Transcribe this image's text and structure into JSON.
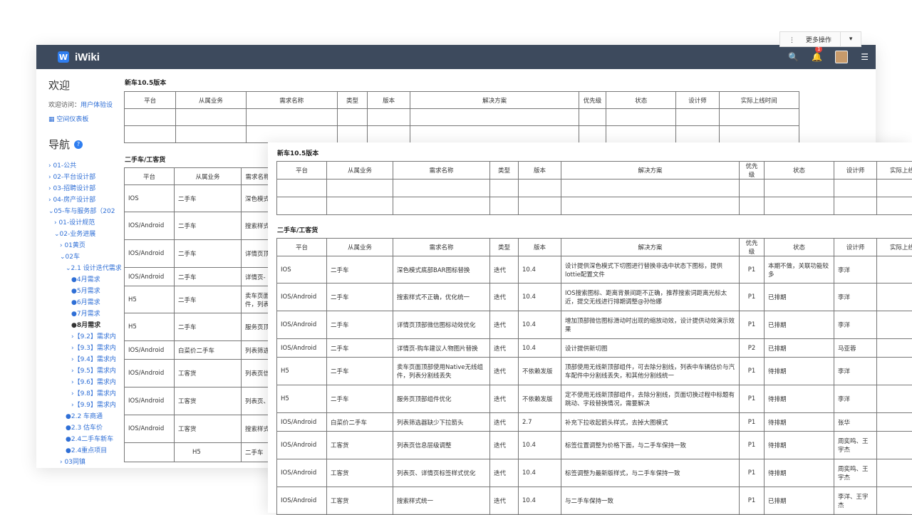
{
  "header": {
    "app_name": "iWiki",
    "logo_letter": "W",
    "notifications_count": "1",
    "search_icon": "🔍",
    "bell_icon": "🔔",
    "menu_icon": "☰"
  },
  "toolbar": {
    "more_actions": "更多操作",
    "more_icon": "⋮",
    "dropdown_icon": "▾"
  },
  "sidebar": {
    "welcome": "欢迎",
    "visit_label": "欢迎访问：",
    "visit_link": "用户体验设",
    "dashboard": "空间仪表板",
    "nav_title": "导航",
    "help_icon": "?",
    "tree": [
      {
        "label": "› 01-公共",
        "indent": 0
      },
      {
        "label": "› 02-平台设计部",
        "indent": 0
      },
      {
        "label": "› 03-招聘设计部",
        "indent": 0
      },
      {
        "label": "› 04-房产设计部",
        "indent": 0
      },
      {
        "label": "⌄05-车与服务部（202",
        "indent": 0
      },
      {
        "label": "› 01-设计规范",
        "indent": 1
      },
      {
        "label": "⌄02-业务进展",
        "indent": 1
      },
      {
        "label": "› 01黄页",
        "indent": 2
      },
      {
        "label": "⌄02车",
        "indent": 2
      },
      {
        "label": "⌄2.1 设计迭代需求",
        "indent": 3
      },
      {
        "label": "●4月需求",
        "indent": 4
      },
      {
        "label": "●5月需求",
        "indent": 4
      },
      {
        "label": "●6月需求",
        "indent": 4
      },
      {
        "label": "●7月需求",
        "indent": 4
      },
      {
        "label": "●8月需求",
        "indent": 4,
        "bold": true
      },
      {
        "label": "›【9.2】需求内",
        "indent": 4
      },
      {
        "label": "›【9.3】需求内",
        "indent": 4
      },
      {
        "label": "›【9.4】需求内",
        "indent": 4
      },
      {
        "label": "›【9.5】需求内",
        "indent": 4
      },
      {
        "label": "›【9.6】需求内",
        "indent": 4
      },
      {
        "label": "›【9.8】需求内",
        "indent": 4
      },
      {
        "label": "›【9.9】需求内",
        "indent": 4
      },
      {
        "label": "●2.2 车商通",
        "indent": 3
      },
      {
        "label": "●2.3 估车价",
        "indent": 3
      },
      {
        "label": "●2.4二手车新车",
        "indent": 3
      },
      {
        "label": "●2.4重点项目",
        "indent": 3
      },
      {
        "label": "› 03同镇",
        "indent": 2
      }
    ]
  },
  "columns": [
    "平台",
    "从属业务",
    "需求名称",
    "类型",
    "版本",
    "解决方案",
    "优先级",
    "状态",
    "设计师",
    "实际上线时间"
  ],
  "section1_title": "新车10.5版本",
  "section2_title": "二手车/工客货",
  "back_rows": [
    [
      "IOS",
      "二手车",
      "深色模式"
    ],
    [
      "IOS/Android",
      "二手车",
      "搜索样式"
    ],
    [
      "IOS/Android",
      "二手车",
      "详情页顶"
    ],
    [
      "IOS/Android",
      "二手车",
      "详情页-"
    ],
    [
      "H5",
      "二手车",
      "卖车页面件，列表"
    ],
    [
      "H5",
      "二手车",
      "服务页顶"
    ],
    [
      "IOS/Android",
      "白菜价二手车",
      "列表筛选"
    ],
    [
      "IOS/Android",
      "工客货",
      "列表页信"
    ],
    [
      "IOS/Android",
      "工客货",
      "列表页、"
    ],
    [
      "IOS/Android",
      "工客货",
      "搜索样式"
    ]
  ],
  "back_extra_row": [
    "H5",
    "二手车"
  ],
  "rows": [
    [
      "IOS",
      "二手车",
      "深色模式底部BAR图标替换",
      "迭代",
      "10.4",
      "设计提供深色模式下切图进行替换非选中状态下图标，提供lottie配置文件",
      "P1",
      "本期不做，关联功能较多",
      "李洋",
      ""
    ],
    [
      "IOS/Android",
      "二手车",
      "搜索样式不正确，优化统一",
      "迭代",
      "10.4",
      "IOS搜索图标、距离背景间距不正确，推荐搜索词距离光标太近，提交无线进行排期调整@孙怡娜",
      "P1",
      "已排期",
      "李洋",
      ""
    ],
    [
      "IOS/Android",
      "二手车",
      "详情页顶部微信图标动效优化",
      "迭代",
      "10.4",
      "增加顶部微信图标滑动时出现的缩放动效，设计提供动效演示效果",
      "P1",
      "已排期",
      "李洋",
      ""
    ],
    [
      "IOS/Android",
      "二手车",
      "详情页-购车建议人物图片替换",
      "迭代",
      "10.4",
      "设计提供新切图",
      "P2",
      "已排期",
      "马亚蓉",
      ""
    ],
    [
      "H5",
      "二手车",
      "卖车页面顶部使用Native无线组件，列表分割线丢失",
      "迭代",
      "不依赖发版",
      "顶部使用无线新顶部组件，可去除分割线，列表中车辆估价与汽车配件中分割线丢失，和其他分割线统一",
      "P1",
      "待排期",
      "李洋",
      ""
    ],
    [
      "H5",
      "二手车",
      "服务页顶部组件优化",
      "迭代",
      "不依赖发版",
      "定不使用无线新顶部组件，去除分割线，页面切换过程中标题有跳动、字段替换情况，需要解决",
      "P1",
      "待排期",
      "李洋",
      ""
    ],
    [
      "IOS/Android",
      "白菜价二手车",
      "列表筛选器缺少下拉箭头",
      "迭代",
      "2.7",
      "补充下拉收起箭头样式，去掉大图模式",
      "P1",
      "待排期",
      "张华",
      ""
    ],
    [
      "IOS/Android",
      "工客货",
      "列表页信息层级调整",
      "迭代",
      "10.4",
      "标签位置调整为价格下面，与二手车保持一致",
      "P1",
      "待排期",
      "周奕鸣、王宇杰",
      ""
    ],
    [
      "IOS/Android",
      "工客货",
      "列表页、详情页标签样式优化",
      "迭代",
      "10.4",
      "标签调整为最新版样式，与二手车保持一致",
      "P1",
      "待排期",
      "周奕鸣、王宇杰",
      ""
    ],
    [
      "IOS/Android",
      "工客货",
      "搜索样式统一",
      "迭代",
      "10.4",
      "与二手车保持一致",
      "P1",
      "已排期",
      "李洋、王宇杰",
      ""
    ]
  ],
  "colors": {
    "topbar": "#3d4a5d",
    "link": "#2f6fd6",
    "badge": "#e8453c",
    "brand": "#2f7ef0"
  }
}
